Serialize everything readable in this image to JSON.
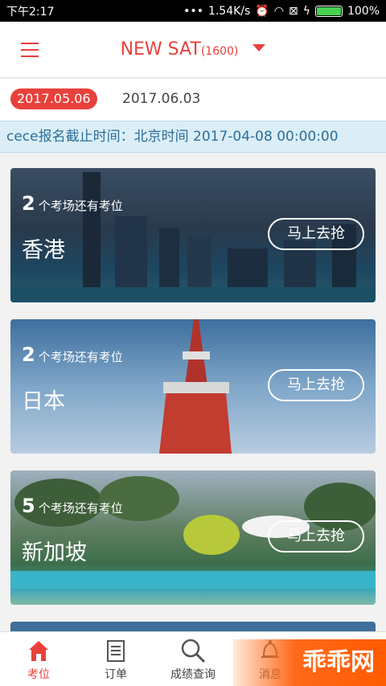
{
  "status_bar": {
    "time": "下午2:17",
    "network_speed": "1.54K/s",
    "battery": "100%"
  },
  "header": {
    "title": "NEW SAT",
    "subtitle": "(1600)"
  },
  "dates": {
    "selected": "2017.05.06",
    "other": "2017.06.03"
  },
  "deadline": "cece报名截止时间：北京时间 2017-04-08 00:00:00",
  "cards": [
    {
      "count": "2",
      "count_text": "个考场还有考位",
      "city": "香港",
      "button": "马上去抢"
    },
    {
      "count": "2",
      "count_text": "个考场还有考位",
      "city": "日本",
      "button": "马上去抢"
    },
    {
      "count": "5",
      "count_text": "个考场还有考位",
      "city": "新加坡",
      "button": "马上去抢"
    }
  ],
  "tabs": [
    {
      "label": "考位",
      "icon": "home-icon"
    },
    {
      "label": "订单",
      "icon": "document-icon"
    },
    {
      "label": "成绩查询",
      "icon": "search-icon"
    },
    {
      "label": "消息",
      "icon": "bell-icon"
    }
  ],
  "watermark": "乖乖网",
  "colors": {
    "accent": "#e8413c",
    "notice_bg": "#dbeef7"
  }
}
